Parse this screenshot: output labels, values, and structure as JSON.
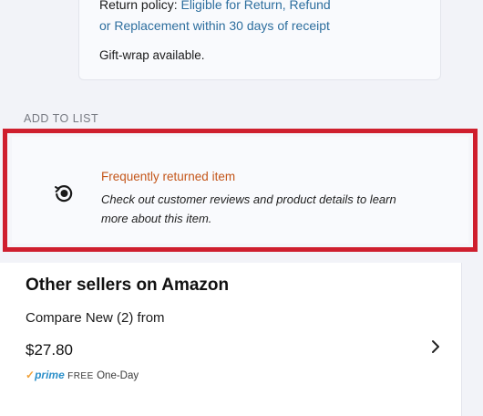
{
  "policy": {
    "prefix": "Return policy: ",
    "link_part1": "Eligible for Return, Refund",
    "link_part2": "or Replacement within 30 days of receipt",
    "gift": "Gift-wrap available."
  },
  "add_to_list": "ADD TO LIST",
  "frequently_returned": {
    "title": "Frequently returned item",
    "description": "Check out customer reviews and product details to learn more about this item.",
    "icon": "return-circle-icon",
    "border_color": "#cf1f2e",
    "title_color": "#c4561a"
  },
  "other_sellers": {
    "title": "Other sellers on Amazon",
    "compare": "Compare New (2) from",
    "price": "$27.80",
    "prime_label": "prime",
    "prime_free": "FREE",
    "prime_delivery": "One-Day",
    "chevron_icon": "chevron-right-icon"
  }
}
